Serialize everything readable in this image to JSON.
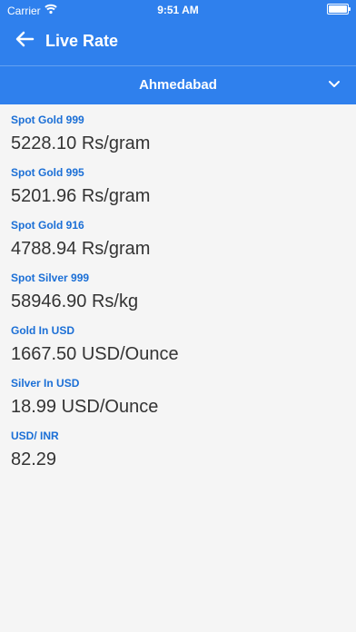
{
  "status_bar": {
    "carrier": "Carrier",
    "time": "9:51 AM"
  },
  "header": {
    "title": "Live Rate"
  },
  "city_selector": {
    "selected": "Ahmedabad"
  },
  "items": [
    {
      "label": "Spot Gold 999",
      "value": "5228.10 Rs/gram"
    },
    {
      "label": "Spot Gold 995",
      "value": "5201.96 Rs/gram"
    },
    {
      "label": "Spot Gold 916",
      "value": "4788.94 Rs/gram"
    },
    {
      "label": "Spot Silver 999",
      "value": "58946.90 Rs/kg"
    },
    {
      "label": "Gold In USD",
      "value": "1667.50 USD/Ounce"
    },
    {
      "label": "Silver In USD",
      "value": "18.99 USD/Ounce"
    },
    {
      "label": "USD/ INR",
      "value": "82.29"
    }
  ],
  "icons": {
    "back": "back-arrow-icon",
    "chevron": "chevron-down-icon",
    "wifi": "wifi-icon",
    "battery": "battery-icon"
  },
  "colors": {
    "header_bg": "#2f80ed",
    "label_color": "#1b6fd6",
    "page_bg": "#f5f5f5"
  }
}
